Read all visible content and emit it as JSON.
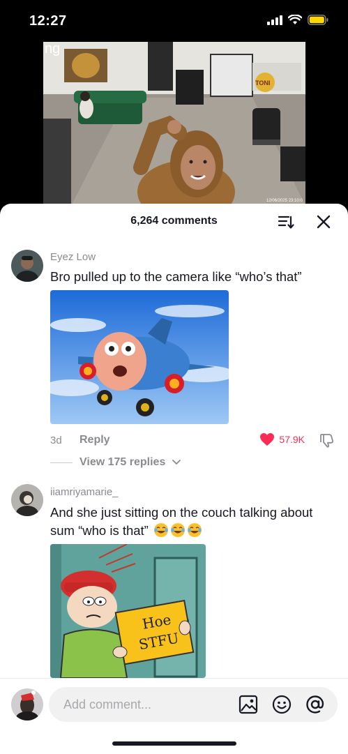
{
  "status_bar": {
    "time": "12:27",
    "icons": [
      "signal-icon",
      "wifi-icon",
      "battery-icon"
    ],
    "battery_color": "#ffd60a"
  },
  "video": {
    "overlay_text": "ng",
    "timestamp": "12/06/2025 23:10:0",
    "sign_text": "TONI"
  },
  "comments_sheet": {
    "count_label": "6,264 comments",
    "sort_icon": "sort-icon",
    "close_icon": "close-icon"
  },
  "comments": [
    {
      "username": "Eyez Low",
      "text": "Bro pulled up to the camera like “who’s that”",
      "date": "3d",
      "reply_label": "Reply",
      "likes": "57.9K",
      "liked": true,
      "view_replies": "View 175 replies",
      "media": "jay-jay-jet-plane-meme"
    },
    {
      "username": "iiamriyamarie_",
      "text": "And she just sitting on the couch talking about sum “who is that”",
      "emojis": [
        "joy-emoji",
        "joy-emoji",
        "joy-emoji"
      ],
      "media": "cartoon-sign-meme",
      "sign_text_1": "Hoe",
      "sign_text_2": "STFU"
    }
  ],
  "composer": {
    "placeholder": "Add comment...",
    "icons": [
      "image-icon",
      "emoji-icon",
      "mention-icon"
    ]
  },
  "colors": {
    "accent": "#fe2c55",
    "text_primary": "#161823",
    "text_secondary": "#8a8b91"
  }
}
